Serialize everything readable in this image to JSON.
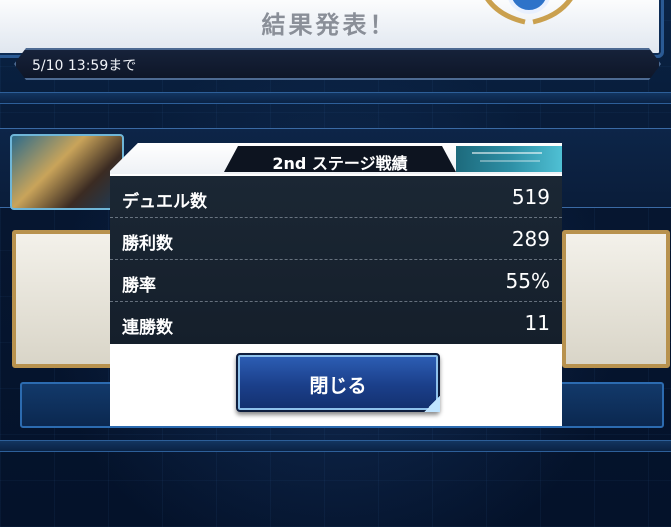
{
  "screen": {
    "title": "結果発表！",
    "deadline": "5/10 13:59まで"
  },
  "modal": {
    "title": "2nd ステージ戦績",
    "stats": [
      {
        "label": "デュエル数",
        "value": "519"
      },
      {
        "label": "勝利数",
        "value": "289"
      },
      {
        "label": "勝率",
        "value": "55%"
      },
      {
        "label": "連勝数",
        "value": "11"
      }
    ],
    "close_label": "閉じる"
  },
  "colors": {
    "background": "#081a33",
    "panel": "#1b2734",
    "button": "#2d5fb6",
    "accent": "#b8924e"
  }
}
